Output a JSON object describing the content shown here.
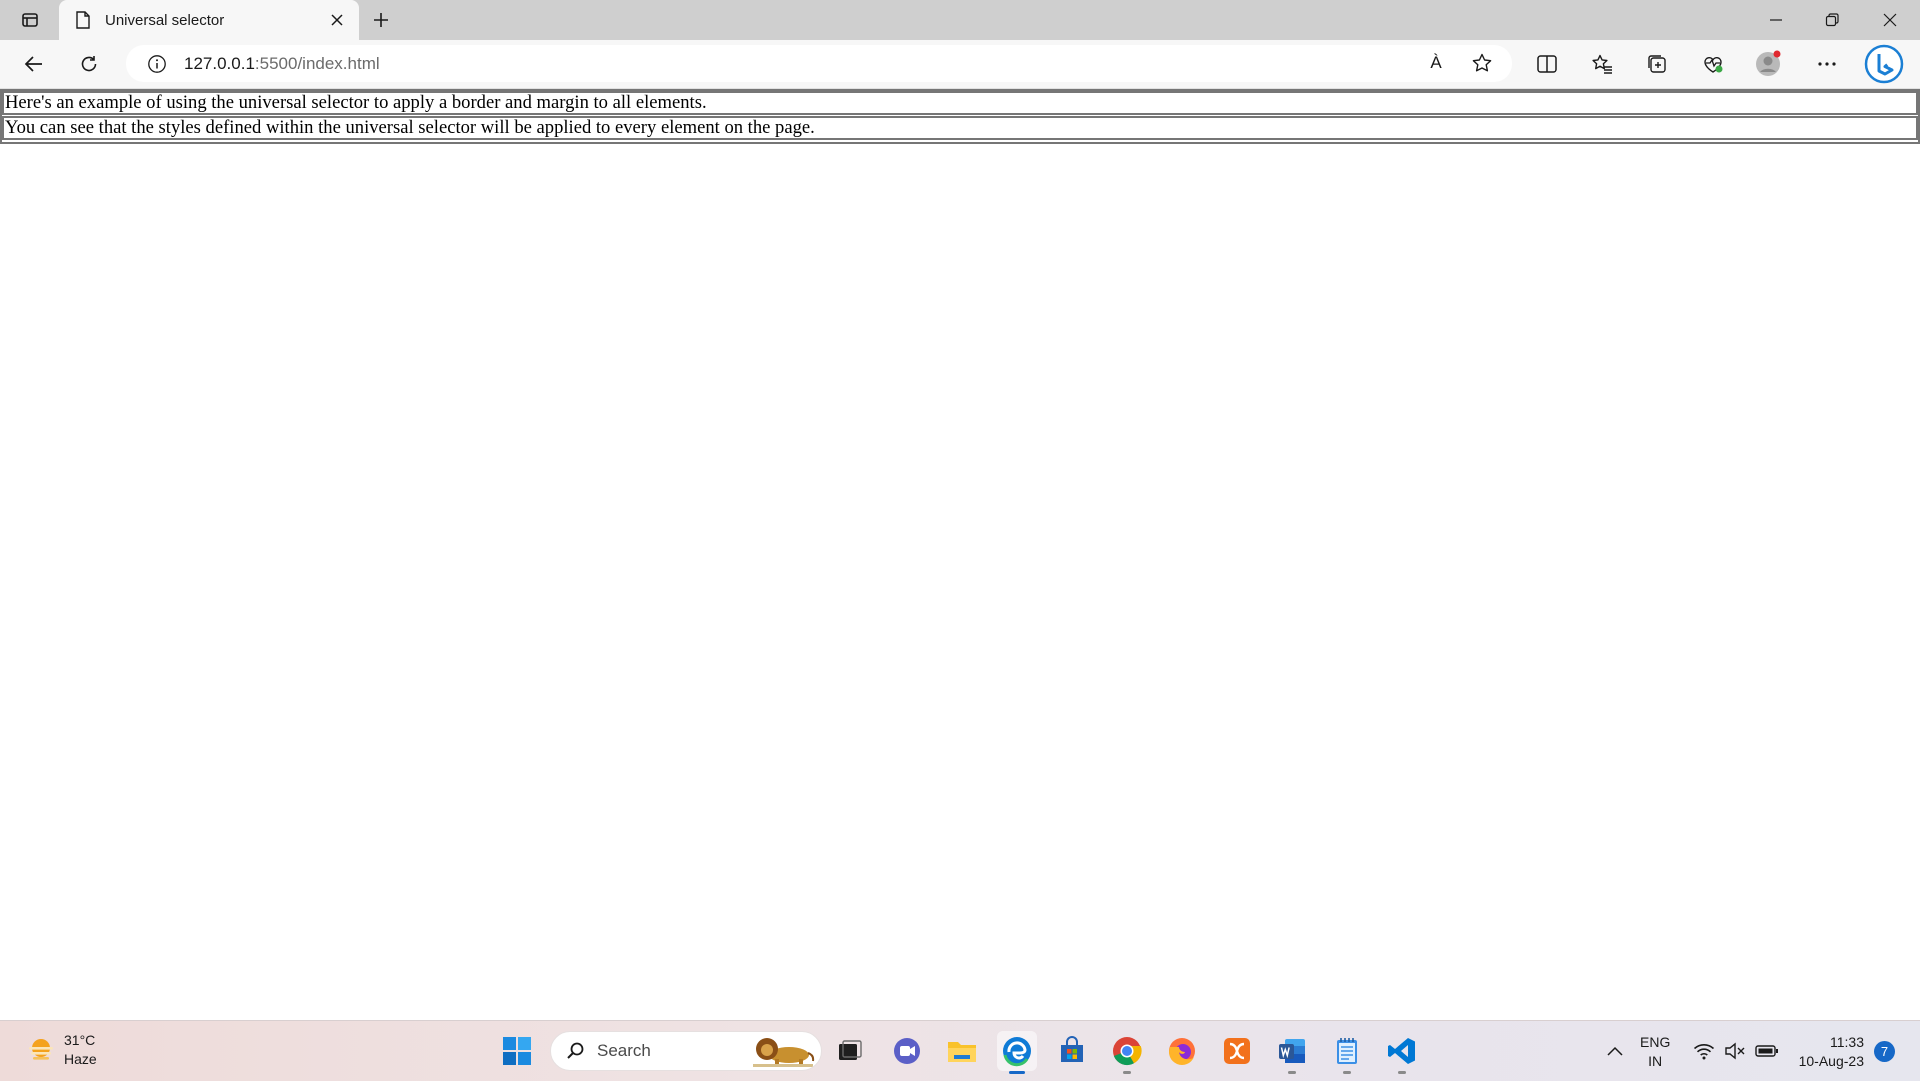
{
  "browser": {
    "tab_title": "Universal selector",
    "url_host": "127.0.0.1",
    "url_path": ":5500/index.html",
    "icons": [
      "tab-actions-icon",
      "page-icon",
      "close-icon",
      "plus-icon",
      "minimize-icon",
      "restore-icon",
      "close-window-icon",
      "back-icon",
      "refresh-icon",
      "info-icon",
      "read-aloud-icon",
      "favorite-star-icon",
      "split-screen-icon",
      "favorites-icon",
      "collections-icon",
      "browser-essentials-icon",
      "profile-icon",
      "more-icon",
      "bing-copilot-icon"
    ],
    "read_aloud_glyph": "À"
  },
  "page": {
    "paragraphs": [
      "Here's an example of using the universal selector to apply a border and margin to all elements.",
      "You can see that the styles defined within the universal selector will be applied to every element on the page."
    ]
  },
  "taskbar": {
    "weather_temp": "31°C",
    "weather_desc": "Haze",
    "search_placeholder": "Search",
    "apps": [
      "windows-start-icon",
      "search-icon",
      "task-view-icon",
      "teams-chat-icon",
      "file-explorer-icon",
      "edge-icon",
      "microsoft-store-icon",
      "chrome-icon",
      "firefox-icon",
      "xampp-icon",
      "word-icon",
      "notepad-icon",
      "vscode-icon"
    ],
    "lang_line1": "ENG",
    "lang_line2": "IN",
    "time": "11:33",
    "date": "10-Aug-23",
    "notification_count": "7",
    "colors": {
      "accent": "#1668c7",
      "edge_blue": "#0f7bd6",
      "word_blue": "#2b5797",
      "vscode_blue": "#0078d4",
      "xampp_orange": "#f2711c"
    }
  }
}
